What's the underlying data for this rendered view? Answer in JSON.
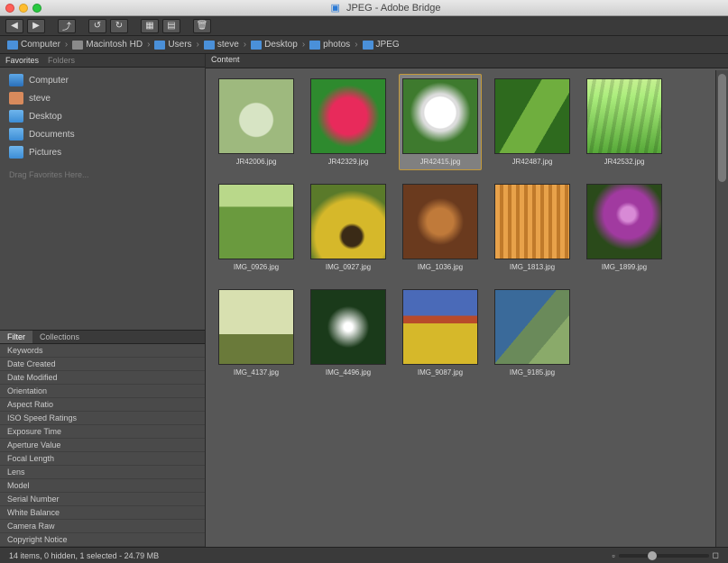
{
  "window": {
    "title": "JPEG - Adobe Bridge"
  },
  "toolbar": {
    "buttons": [
      "back",
      "forward",
      "reveal",
      "rotate-ccw",
      "rotate-cw",
      "trash",
      "camera",
      "refine",
      "output"
    ]
  },
  "breadcrumb": [
    {
      "label": "Computer",
      "color": "#4a90d9"
    },
    {
      "label": "Macintosh HD",
      "color": "#8a8a8a"
    },
    {
      "label": "Users",
      "color": "#4a90d9"
    },
    {
      "label": "steve",
      "color": "#4a90d9"
    },
    {
      "label": "Desktop",
      "color": "#4a90d9"
    },
    {
      "label": "photos",
      "color": "#4a90d9"
    },
    {
      "label": "JPEG",
      "color": "#4a90d9"
    }
  ],
  "panels": {
    "favorites_tab": "Favorites",
    "folders_tab": "Folders",
    "content_tab": "Content",
    "filter_tab": "Filter",
    "collections_tab": "Collections",
    "drag_hint": "Drag Favorites Here..."
  },
  "favorites": [
    {
      "label": "Computer",
      "icon": "computer"
    },
    {
      "label": "steve",
      "icon": "home"
    },
    {
      "label": "Desktop",
      "icon": "folder"
    },
    {
      "label": "Documents",
      "icon": "folder"
    },
    {
      "label": "Pictures",
      "icon": "folder"
    }
  ],
  "filters": [
    "Keywords",
    "Date Created",
    "Date Modified",
    "Orientation",
    "Aspect Ratio",
    "ISO Speed Ratings",
    "Exposure Time",
    "Aperture Value",
    "Focal Length",
    "Lens",
    "Model",
    "Serial Number",
    "White Balance",
    "Camera Raw",
    "Copyright Notice"
  ],
  "thumbnails": [
    {
      "label": "JR42006.jpg",
      "art": "a1",
      "selected": false
    },
    {
      "label": "JR42329.jpg",
      "art": "a2",
      "selected": false
    },
    {
      "label": "JR42415.jpg",
      "art": "a3",
      "selected": true
    },
    {
      "label": "JR42487.jpg",
      "art": "a4",
      "selected": false
    },
    {
      "label": "JR42532.jpg",
      "art": "a5",
      "selected": false
    },
    {
      "label": "IMG_0926.jpg",
      "art": "a6",
      "selected": false
    },
    {
      "label": "IMG_0927.jpg",
      "art": "a7",
      "selected": false
    },
    {
      "label": "IMG_1036.jpg",
      "art": "a8",
      "selected": false
    },
    {
      "label": "IMG_1813.jpg",
      "art": "a9",
      "selected": false
    },
    {
      "label": "IMG_1899.jpg",
      "art": "a10",
      "selected": false
    },
    {
      "label": "IMG_4137.jpg",
      "art": "a11",
      "selected": false
    },
    {
      "label": "IMG_4496.jpg",
      "art": "a12",
      "selected": false
    },
    {
      "label": "IMG_9087.jpg",
      "art": "a13",
      "selected": false
    },
    {
      "label": "IMG_9185.jpg",
      "art": "a14",
      "selected": false
    }
  ],
  "status": {
    "text": "14 items, 0 hidden, 1 selected - 24.79 MB"
  }
}
